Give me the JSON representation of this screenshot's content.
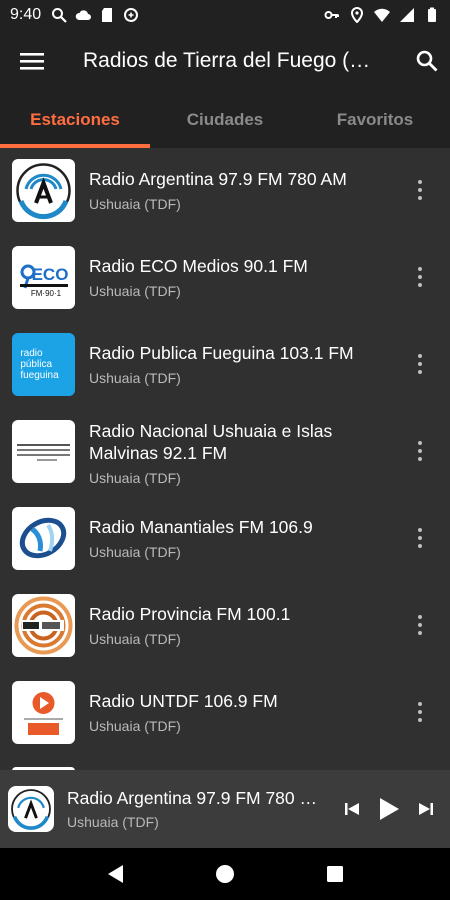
{
  "status_bar": {
    "time": "9:40",
    "left_icons": [
      "search-icon",
      "cloud-icon",
      "sd-card-icon",
      "vpn-icon"
    ],
    "right_icons": [
      "key-icon",
      "location-icon",
      "wifi-icon",
      "signal-icon",
      "battery-icon"
    ]
  },
  "app_bar": {
    "title": "Radios de Tierra del Fuego (…",
    "menu_icon": "hamburger-menu-icon",
    "search_icon": "search-icon"
  },
  "tabs": [
    {
      "label": "Estaciones",
      "active": true
    },
    {
      "label": "Ciudades",
      "active": false
    },
    {
      "label": "Favoritos",
      "active": false
    }
  ],
  "stations": [
    {
      "name": "Radio Argentina 97.9 FM 780 AM",
      "city": "Ushuaia (TDF)",
      "logo": "radio-argentina-logo"
    },
    {
      "name": "Radio ECO Medios 90.1 FM",
      "city": "Ushuaia (TDF)",
      "logo": "eco-medios-logo"
    },
    {
      "name": "Radio Publica Fueguina 103.1 FM",
      "city": "Ushuaia (TDF)",
      "logo": "radio-publica-fueguina-logo",
      "logo_text": "radio\npública\nfueguina"
    },
    {
      "name": "Radio Nacional Ushuaia e Islas Malvinas 92.1 FM",
      "city": "Ushuaia (TDF)",
      "logo": "radio-nacional-logo"
    },
    {
      "name": "Radio Manantiales FM 106.9",
      "city": "Ushuaia (TDF)",
      "logo": "radio-manantiales-logo"
    },
    {
      "name": "Radio Provincia FM 100.1",
      "city": "Ushuaia (TDF)",
      "logo": "radio-provincia-logo"
    },
    {
      "name": "Radio UNTDF 106.9 FM",
      "city": "Ushuaia (TDF)",
      "logo": "radio-untdf-logo"
    }
  ],
  "player": {
    "title": "Radio Argentina 97.9 FM 780 …",
    "subtitle": "Ushuaia (TDF)",
    "controls": [
      "skip-previous-icon",
      "play-icon",
      "skip-next-icon"
    ]
  },
  "nav_bar": [
    "back-icon",
    "home-icon",
    "recents-icon"
  ],
  "colors": {
    "accent": "#ff6e40",
    "appbar": "#212121",
    "background": "#303030",
    "player": "#3c3c3c"
  }
}
